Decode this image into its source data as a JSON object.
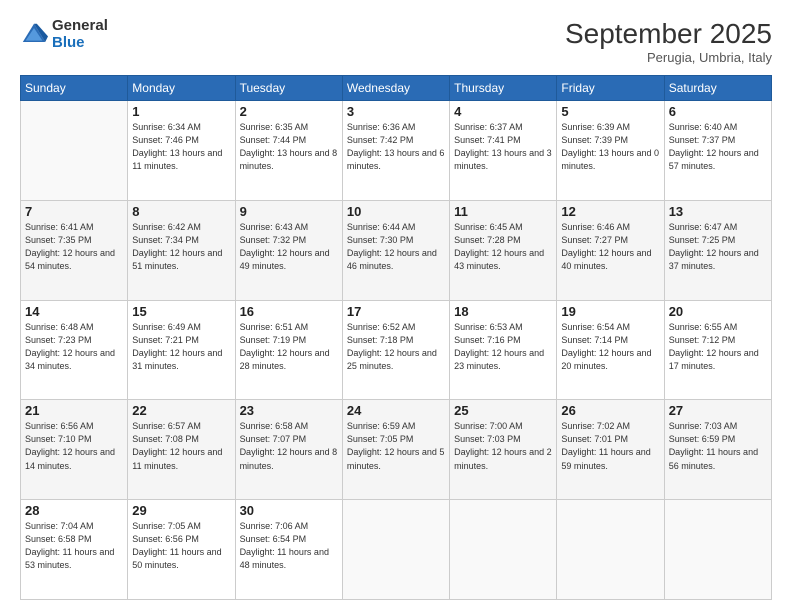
{
  "logo": {
    "general": "General",
    "blue": "Blue"
  },
  "header": {
    "month": "September 2025",
    "location": "Perugia, Umbria, Italy"
  },
  "days": [
    "Sunday",
    "Monday",
    "Tuesday",
    "Wednesday",
    "Thursday",
    "Friday",
    "Saturday"
  ],
  "weeks": [
    [
      {
        "day": "",
        "content": ""
      },
      {
        "day": "1",
        "content": "Sunrise: 6:34 AM\nSunset: 7:46 PM\nDaylight: 13 hours\nand 11 minutes."
      },
      {
        "day": "2",
        "content": "Sunrise: 6:35 AM\nSunset: 7:44 PM\nDaylight: 13 hours\nand 8 minutes."
      },
      {
        "day": "3",
        "content": "Sunrise: 6:36 AM\nSunset: 7:42 PM\nDaylight: 13 hours\nand 6 minutes."
      },
      {
        "day": "4",
        "content": "Sunrise: 6:37 AM\nSunset: 7:41 PM\nDaylight: 13 hours\nand 3 minutes."
      },
      {
        "day": "5",
        "content": "Sunrise: 6:39 AM\nSunset: 7:39 PM\nDaylight: 13 hours\nand 0 minutes."
      },
      {
        "day": "6",
        "content": "Sunrise: 6:40 AM\nSunset: 7:37 PM\nDaylight: 12 hours\nand 57 minutes."
      }
    ],
    [
      {
        "day": "7",
        "content": "Sunrise: 6:41 AM\nSunset: 7:35 PM\nDaylight: 12 hours\nand 54 minutes."
      },
      {
        "day": "8",
        "content": "Sunrise: 6:42 AM\nSunset: 7:34 PM\nDaylight: 12 hours\nand 51 minutes."
      },
      {
        "day": "9",
        "content": "Sunrise: 6:43 AM\nSunset: 7:32 PM\nDaylight: 12 hours\nand 49 minutes."
      },
      {
        "day": "10",
        "content": "Sunrise: 6:44 AM\nSunset: 7:30 PM\nDaylight: 12 hours\nand 46 minutes."
      },
      {
        "day": "11",
        "content": "Sunrise: 6:45 AM\nSunset: 7:28 PM\nDaylight: 12 hours\nand 43 minutes."
      },
      {
        "day": "12",
        "content": "Sunrise: 6:46 AM\nSunset: 7:27 PM\nDaylight: 12 hours\nand 40 minutes."
      },
      {
        "day": "13",
        "content": "Sunrise: 6:47 AM\nSunset: 7:25 PM\nDaylight: 12 hours\nand 37 minutes."
      }
    ],
    [
      {
        "day": "14",
        "content": "Sunrise: 6:48 AM\nSunset: 7:23 PM\nDaylight: 12 hours\nand 34 minutes."
      },
      {
        "day": "15",
        "content": "Sunrise: 6:49 AM\nSunset: 7:21 PM\nDaylight: 12 hours\nand 31 minutes."
      },
      {
        "day": "16",
        "content": "Sunrise: 6:51 AM\nSunset: 7:19 PM\nDaylight: 12 hours\nand 28 minutes."
      },
      {
        "day": "17",
        "content": "Sunrise: 6:52 AM\nSunset: 7:18 PM\nDaylight: 12 hours\nand 25 minutes."
      },
      {
        "day": "18",
        "content": "Sunrise: 6:53 AM\nSunset: 7:16 PM\nDaylight: 12 hours\nand 23 minutes."
      },
      {
        "day": "19",
        "content": "Sunrise: 6:54 AM\nSunset: 7:14 PM\nDaylight: 12 hours\nand 20 minutes."
      },
      {
        "day": "20",
        "content": "Sunrise: 6:55 AM\nSunset: 7:12 PM\nDaylight: 12 hours\nand 17 minutes."
      }
    ],
    [
      {
        "day": "21",
        "content": "Sunrise: 6:56 AM\nSunset: 7:10 PM\nDaylight: 12 hours\nand 14 minutes."
      },
      {
        "day": "22",
        "content": "Sunrise: 6:57 AM\nSunset: 7:08 PM\nDaylight: 12 hours\nand 11 minutes."
      },
      {
        "day": "23",
        "content": "Sunrise: 6:58 AM\nSunset: 7:07 PM\nDaylight: 12 hours\nand 8 minutes."
      },
      {
        "day": "24",
        "content": "Sunrise: 6:59 AM\nSunset: 7:05 PM\nDaylight: 12 hours\nand 5 minutes."
      },
      {
        "day": "25",
        "content": "Sunrise: 7:00 AM\nSunset: 7:03 PM\nDaylight: 12 hours\nand 2 minutes."
      },
      {
        "day": "26",
        "content": "Sunrise: 7:02 AM\nSunset: 7:01 PM\nDaylight: 11 hours\nand 59 minutes."
      },
      {
        "day": "27",
        "content": "Sunrise: 7:03 AM\nSunset: 6:59 PM\nDaylight: 11 hours\nand 56 minutes."
      }
    ],
    [
      {
        "day": "28",
        "content": "Sunrise: 7:04 AM\nSunset: 6:58 PM\nDaylight: 11 hours\nand 53 minutes."
      },
      {
        "day": "29",
        "content": "Sunrise: 7:05 AM\nSunset: 6:56 PM\nDaylight: 11 hours\nand 50 minutes."
      },
      {
        "day": "30",
        "content": "Sunrise: 7:06 AM\nSunset: 6:54 PM\nDaylight: 11 hours\nand 48 minutes."
      },
      {
        "day": "",
        "content": ""
      },
      {
        "day": "",
        "content": ""
      },
      {
        "day": "",
        "content": ""
      },
      {
        "day": "",
        "content": ""
      }
    ]
  ]
}
